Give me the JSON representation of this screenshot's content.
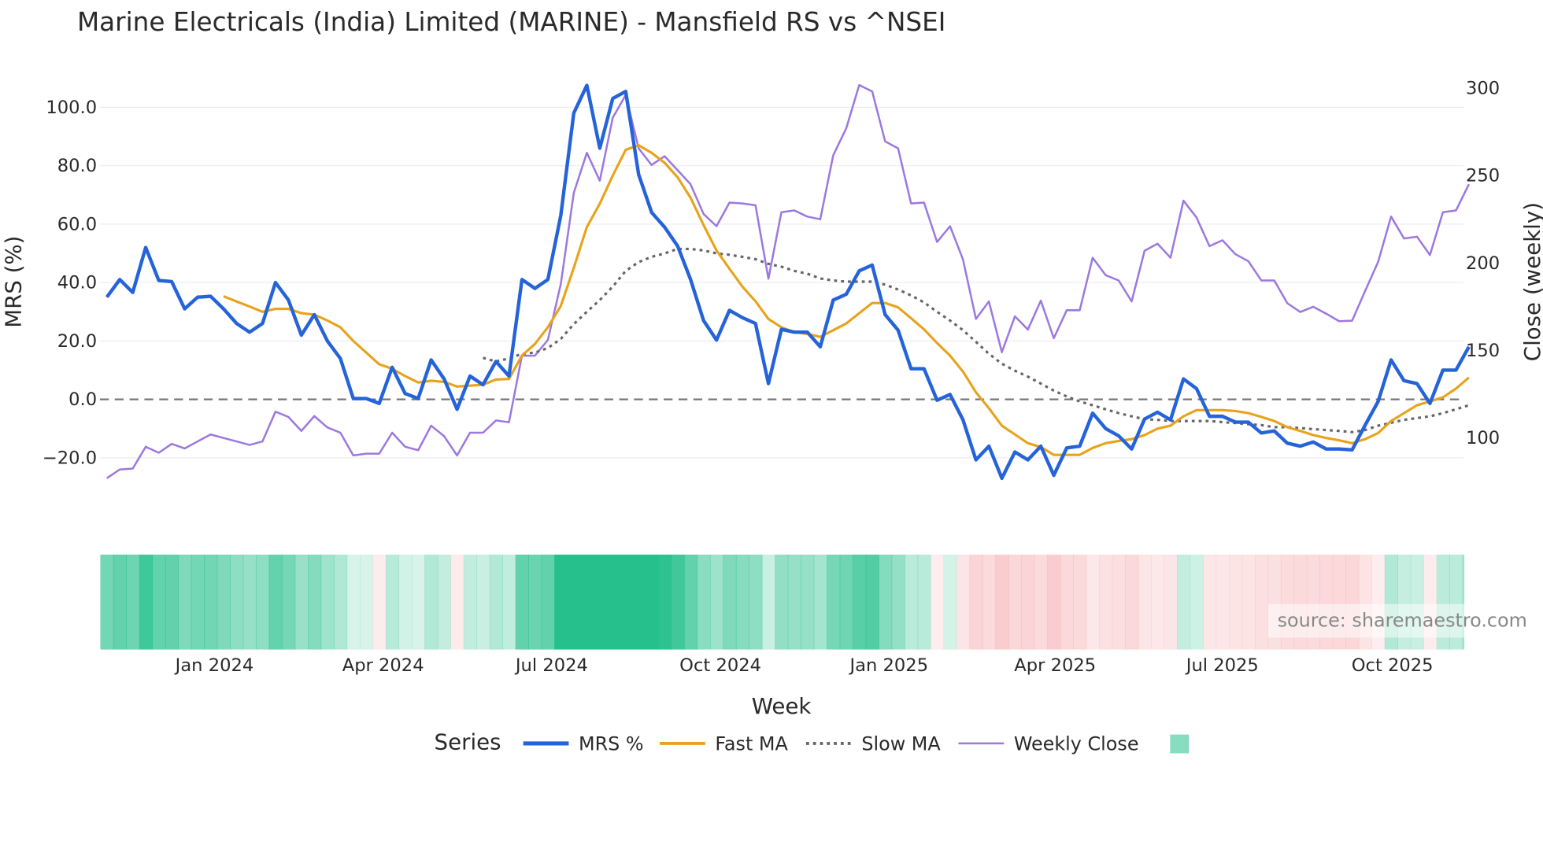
{
  "chart_data": {
    "type": "line",
    "title": "Marine Electricals (India) Limited (MARINE) - Mansfield RS vs ^NSEI",
    "xlabel": "Week",
    "ylabel": "MRS (%)",
    "y2label": "Close (weekly)",
    "ylim": [
      -30,
      110
    ],
    "y2lim": [
      60,
      305
    ],
    "yticks": [
      -20,
      0,
      20,
      40,
      60,
      80,
      100
    ],
    "ytick_labels": [
      "−20.0",
      "0.0",
      "20.0",
      "40.0",
      "60.0",
      "80.0",
      "100.0"
    ],
    "y2ticks": [
      100,
      150,
      200,
      250,
      300
    ],
    "y2tick_labels": [
      "100",
      "150",
      "200",
      "250",
      "300"
    ],
    "x_unit": "week index",
    "xticks": [
      {
        "label": "Jan 2024",
        "at": 8.3
      },
      {
        "label": "Apr 2024",
        "at": 21.3
      },
      {
        "label": "Jul 2024",
        "at": 34.3
      },
      {
        "label": "Oct 2024",
        "at": 47.3
      },
      {
        "label": "Jan 2025",
        "at": 60.3
      },
      {
        "label": "Apr 2025",
        "at": 73.1
      },
      {
        "label": "Jul 2025",
        "at": 86.0
      },
      {
        "label": "Oct 2025",
        "at": 99.1
      }
    ],
    "zero_line": 0,
    "grid": true,
    "legend": {
      "title": "Series",
      "placement": "bottom"
    },
    "series": [
      {
        "name": "MRS %",
        "color": "#2563d9",
        "axis": "left",
        "offset": 0,
        "values": [
          35,
          41,
          36.6,
          52,
          40.7,
          40.3,
          31,
          35,
          35.3,
          31,
          26,
          23,
          26,
          40,
          34,
          22,
          29,
          20,
          14,
          0.3,
          0.3,
          -1.4,
          11,
          2,
          0.3,
          13.5,
          7,
          -3.4,
          8,
          5,
          13,
          8,
          41,
          38,
          41,
          63,
          98,
          107.5,
          86,
          103,
          105.4,
          77,
          64,
          59,
          52.5,
          41,
          27,
          20.3,
          30.5,
          28,
          26,
          5.4,
          24,
          23,
          23,
          18,
          34,
          36,
          44,
          46,
          29,
          23.7,
          10.5,
          10.5,
          -0.3,
          1.7,
          -7,
          -20.7,
          -16,
          -27,
          -18,
          -20.7,
          -16,
          -26,
          -16.6,
          -16,
          -4.7,
          -10,
          -12.5,
          -17,
          -6.7,
          -4.4,
          -7,
          7,
          3.7,
          -5.8,
          -5.8,
          -7.8,
          -7.8,
          -11.5,
          -10.8,
          -15,
          -16,
          -14.6,
          -17,
          -17,
          -17.3,
          -8.8,
          -0.7,
          13.5,
          6.4,
          5.4,
          -1.4,
          10,
          10,
          18
        ]
      },
      {
        "name": "Fast MA",
        "color": "#e8a31c",
        "axis": "left",
        "offset": 9,
        "values": [
          35.3,
          33.5,
          31.8,
          30,
          31,
          31,
          29.5,
          29,
          27,
          24.7,
          20,
          16,
          12,
          10.5,
          8,
          5.8,
          6.4,
          6,
          4.4,
          4.7,
          5,
          6.8,
          7,
          15,
          19,
          24.7,
          32,
          45,
          59,
          67,
          76.6,
          85.4,
          87,
          84.4,
          81,
          76,
          69,
          59.7,
          51,
          44.7,
          38.6,
          33.6,
          27.5,
          24.7,
          23,
          22.4,
          21.4,
          23.7,
          26,
          29.5,
          33,
          33,
          31.5,
          27.8,
          24,
          19.3,
          15,
          9.5,
          2.4,
          -3,
          -9,
          -12,
          -15,
          -16.3,
          -19,
          -19,
          -19,
          -16.6,
          -15,
          -14.2,
          -13.6,
          -12.2,
          -10,
          -9,
          -5.8,
          -3.7,
          -3.7,
          -3.7,
          -4,
          -4.7,
          -6,
          -7.4,
          -9.5,
          -10.8,
          -12.2,
          -13.2,
          -14,
          -15,
          -13.6,
          -11.5,
          -7.4,
          -4.7,
          -2,
          -0.7,
          0.7,
          3.7,
          7.5
        ]
      },
      {
        "name": "Slow MA",
        "color": "#666666",
        "axis": "left",
        "offset": 29,
        "dash": true,
        "values": [
          14.2,
          13,
          14,
          15.6,
          16,
          17.6,
          20.7,
          25.8,
          30,
          34,
          38.6,
          44,
          47,
          48.8,
          50,
          51.5,
          51.5,
          51,
          50,
          49.5,
          48.8,
          48,
          46.4,
          45.4,
          44,
          43,
          41.4,
          40.7,
          40.3,
          40.3,
          40.3,
          39.3,
          37.6,
          35.6,
          33.2,
          30,
          27,
          23.7,
          19.7,
          15.6,
          12.2,
          9.8,
          7.8,
          5.4,
          3,
          1,
          -0.7,
          -2,
          -3.4,
          -4.7,
          -5.8,
          -6.8,
          -7,
          -7.4,
          -7.4,
          -7.4,
          -7.4,
          -7.8,
          -8.1,
          -8.5,
          -8.8,
          -9.5,
          -9.5,
          -9.8,
          -10.2,
          -10.5,
          -10.8,
          -11.2,
          -10.5,
          -9,
          -8,
          -7,
          -6.4,
          -5.8,
          -4.7,
          -3.4,
          -2
        ]
      },
      {
        "name": "Weekly Close",
        "color": "#9c78e0",
        "axis": "right",
        "offset": 0,
        "values": [
          77,
          82,
          82.5,
          95,
          91.5,
          96.6,
          94,
          98,
          102,
          100,
          98,
          96,
          98,
          115,
          112,
          104,
          112.5,
          106,
          103,
          90,
          91,
          91,
          103,
          95,
          93,
          107,
          101,
          90,
          103,
          103,
          110,
          109,
          147,
          147,
          156,
          188,
          240,
          263,
          247,
          283,
          296,
          265.5,
          256,
          261,
          253,
          245,
          228,
          221,
          234.5,
          234,
          233,
          191,
          229,
          230,
          226.5,
          225,
          261.5,
          277,
          301.7,
          298,
          269.5,
          265.5,
          234,
          234.5,
          212,
          221,
          202,
          168,
          178,
          149,
          169.5,
          162,
          178.5,
          157,
          173,
          173,
          203,
          193,
          190,
          178,
          207,
          211,
          203,
          235.6,
          226,
          209.6,
          213,
          205,
          201,
          190,
          190,
          177,
          172,
          175,
          171,
          166.7,
          167,
          184,
          200.6,
          226.5,
          214,
          215,
          204.5,
          229,
          230,
          245
        ]
      }
    ],
    "heatmap": {
      "source_series": "MRS %",
      "positive_color": "#26c08c",
      "negative_color": "#f4a0a4"
    }
  },
  "source_note": "source: sharemaestro.com"
}
